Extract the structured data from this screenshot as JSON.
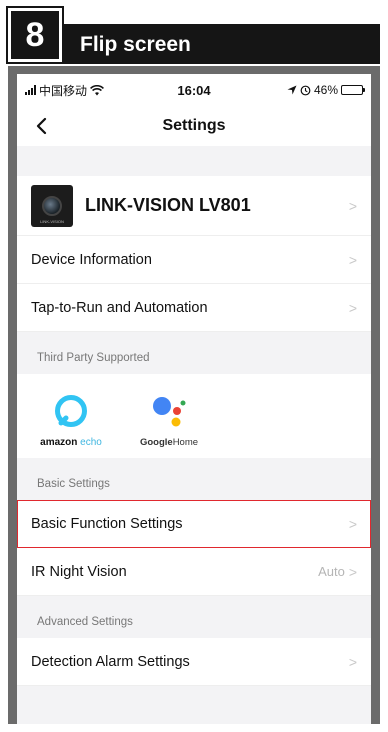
{
  "step": {
    "number": "8",
    "title": "Flip screen"
  },
  "status_bar": {
    "carrier": "中国移动",
    "time": "16:04",
    "battery": "46%",
    "battery_level": 0.46
  },
  "nav": {
    "title": "Settings"
  },
  "device": {
    "name": "LINK-VISION LV801",
    "thumb_label": "LINK-VISION"
  },
  "rows": {
    "device_info": "Device Information",
    "tap_to_run": "Tap-to-Run and Automation"
  },
  "third_party": {
    "section_label": "Third Party Supported",
    "amazon": {
      "brand": "amazon",
      "product": " echo"
    },
    "google": {
      "brand": "Google",
      "product": "Home"
    }
  },
  "basic": {
    "section_label": "Basic Settings",
    "function_settings": "Basic Function Settings",
    "ir_night_vision": "IR Night Vision",
    "ir_value": "Auto"
  },
  "advanced": {
    "section_label": "Advanced Settings",
    "detection_alarm": "Detection Alarm Settings"
  },
  "colors": {
    "highlight": "#e0282e",
    "alexa_blue": "#31c4f3"
  }
}
